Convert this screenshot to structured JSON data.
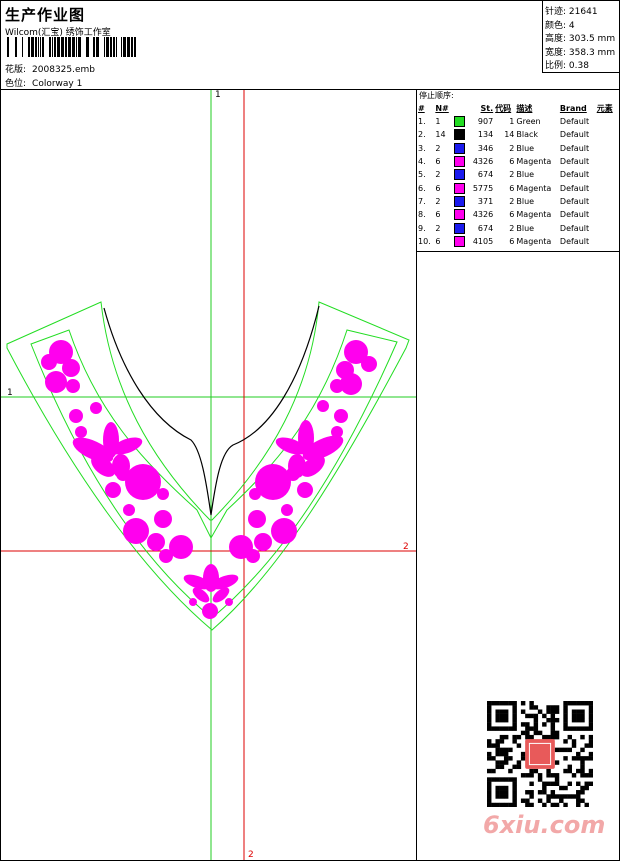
{
  "header": {
    "title": "生产作业图",
    "company": "Wilcom(汇宝) 绣饰工作室",
    "file_label": "花版:",
    "file_value": "2008325.emb",
    "colorway_label": "色位:",
    "colorway_value": "Colorway 1"
  },
  "stats": [
    {
      "label": "针迹:",
      "value": "21641"
    },
    {
      "label": "颜色:",
      "value": "4"
    },
    {
      "label": "高度:",
      "value": "303.5 mm"
    },
    {
      "label": "宽度:",
      "value": "358.3 mm"
    },
    {
      "label": "比例:",
      "value": "0.38"
    }
  ],
  "design": {
    "axis_labels": {
      "green_v_top": "1",
      "green_h_left": "1",
      "red_h_right": "2",
      "red_v_bottom": "2"
    }
  },
  "stop_sequence": {
    "title": "停止顺序:",
    "headers": [
      "#",
      "N#",
      "St.",
      "代码",
      "描述",
      "Brand",
      "元素"
    ],
    "rows": [
      {
        "n": "1.",
        "needle": "1",
        "st": "907",
        "code": "1",
        "desc": "Green",
        "brand": "Default",
        "color": "#22dd22"
      },
      {
        "n": "2.",
        "needle": "14",
        "st": "134",
        "code": "14",
        "desc": "Black",
        "brand": "Default",
        "color": "#000000"
      },
      {
        "n": "3.",
        "needle": "2",
        "st": "346",
        "code": "2",
        "desc": "Blue",
        "brand": "Default",
        "color": "#1a1aee"
      },
      {
        "n": "4.",
        "needle": "6",
        "st": "4326",
        "code": "6",
        "desc": "Magenta",
        "brand": "Default",
        "color": "#ff00ee"
      },
      {
        "n": "5.",
        "needle": "2",
        "st": "674",
        "code": "2",
        "desc": "Blue",
        "brand": "Default",
        "color": "#1a1aee"
      },
      {
        "n": "6.",
        "needle": "6",
        "st": "5775",
        "code": "6",
        "desc": "Magenta",
        "brand": "Default",
        "color": "#ff00ee"
      },
      {
        "n": "7.",
        "needle": "2",
        "st": "371",
        "code": "2",
        "desc": "Blue",
        "brand": "Default",
        "color": "#1a1aee"
      },
      {
        "n": "8.",
        "needle": "6",
        "st": "4326",
        "code": "6",
        "desc": "Magenta",
        "brand": "Default",
        "color": "#ff00ee"
      },
      {
        "n": "9.",
        "needle": "2",
        "st": "674",
        "code": "2",
        "desc": "Blue",
        "brand": "Default",
        "color": "#1a1aee"
      },
      {
        "n": "10.",
        "needle": "6",
        "st": "4105",
        "code": "6",
        "desc": "Magenta",
        "brand": "Default",
        "color": "#ff00ee"
      }
    ]
  },
  "watermark": "6xiu.com",
  "colors": {
    "magenta": "#ff00ee",
    "guide_green": "#22cc22",
    "guide_red": "#dd0000",
    "outline_green": "#22dd22"
  }
}
